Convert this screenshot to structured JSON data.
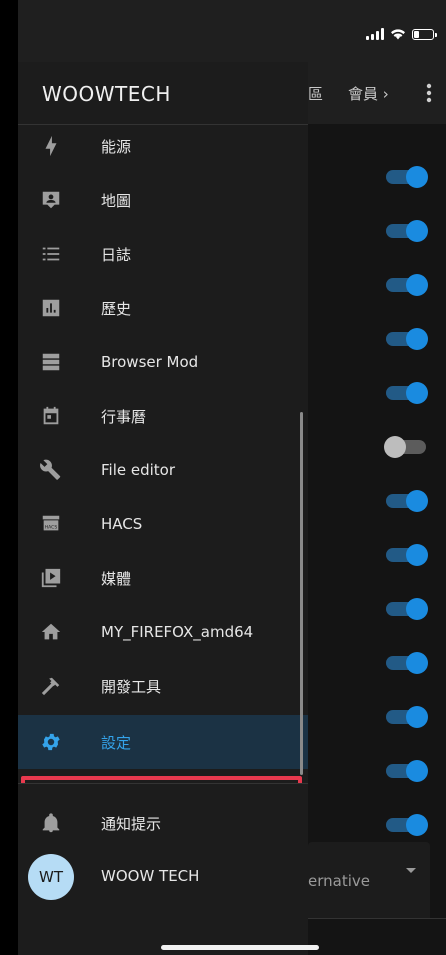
{
  "status_bar": {
    "signal": "signal-icon",
    "wifi": "wifi-icon",
    "battery": "battery-icon"
  },
  "background": {
    "tabs": [
      {
        "label": "區"
      },
      {
        "label": "會員"
      }
    ],
    "more_icon": "more-vert-icon",
    "toggles": [
      {
        "on": true
      },
      {
        "on": true
      },
      {
        "on": true
      },
      {
        "on": true
      },
      {
        "on": true
      },
      {
        "on": false
      },
      {
        "on": true
      },
      {
        "on": true
      },
      {
        "on": true
      },
      {
        "on": true
      },
      {
        "on": true
      },
      {
        "on": true
      },
      {
        "on": true
      }
    ],
    "select": {
      "value": "ernative"
    }
  },
  "drawer": {
    "title": "WOOWTECH",
    "items": [
      {
        "label": "能源",
        "icon": "lightning-bolt-icon"
      },
      {
        "label": "地圖",
        "icon": "account-box-icon"
      },
      {
        "label": "日誌",
        "icon": "format-list-checks-icon"
      },
      {
        "label": "歷史",
        "icon": "chart-box-icon"
      },
      {
        "label": "Browser Mod",
        "icon": "server-icon"
      },
      {
        "label": "行事曆",
        "icon": "calendar-icon"
      },
      {
        "label": "File editor",
        "icon": "wrench-icon"
      },
      {
        "label": "HACS",
        "icon": "hacs-icon",
        "icon_text": "HACS"
      },
      {
        "label": "媒體",
        "icon": "play-box-multiple-icon"
      },
      {
        "label": "MY_FIREFOX_amd64",
        "icon": "home-icon"
      },
      {
        "label": "開發工具",
        "icon": "hammer-icon"
      },
      {
        "label": "設定",
        "icon": "cog-icon",
        "active": true
      }
    ],
    "notifications": {
      "label": "通知提示",
      "icon": "bell-icon"
    },
    "user": {
      "initials": "WT",
      "name": "WOOW TECH"
    }
  },
  "colors": {
    "accent": "#34a3ea",
    "toggle_on": "#1a8be0",
    "highlight": "#e8394e"
  }
}
